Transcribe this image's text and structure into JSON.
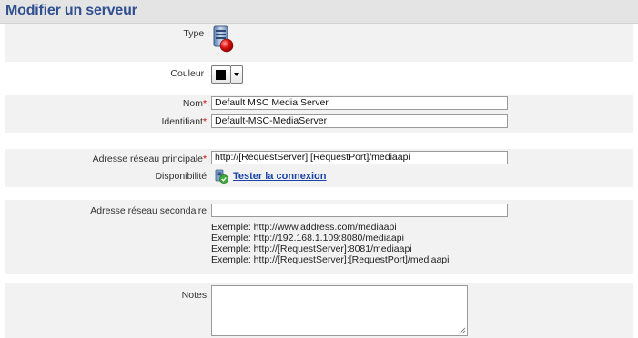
{
  "page": {
    "title": "Modifier un serveur"
  },
  "form": {
    "type_label": "Type :",
    "color_label": "Couleur :",
    "color_value": "#000000",
    "name_label": "Nom",
    "name_value": "Default MSC Media Server",
    "id_label": "Identifiant",
    "id_value": "Default-MSC-MediaServer",
    "required_mark": "*",
    "colon": ":",
    "primary_label": "Adresse réseau principale",
    "primary_value": "http://[RequestServer]:[RequestPort]/mediaapi",
    "availability_label": "Disponibilité:",
    "test_link": "Tester la connexion",
    "secondary_label": "Adresse réseau secondaire:",
    "secondary_value": "",
    "examples": [
      "Exemple: http://www.address.com/mediaapi",
      "Exemple: http://192.168.1.109:8080/mediaapi",
      "Exemple: http://[RequestServer]:8081/mediaapi",
      "Exemple: http://[RequestServer]:[RequestPort]/mediaapi"
    ],
    "notes_label": "Notes:",
    "notes_value": ""
  },
  "icons": {
    "server": "server-error-icon",
    "dropdown": "chevron-down-icon",
    "connection": "server-check-icon"
  }
}
